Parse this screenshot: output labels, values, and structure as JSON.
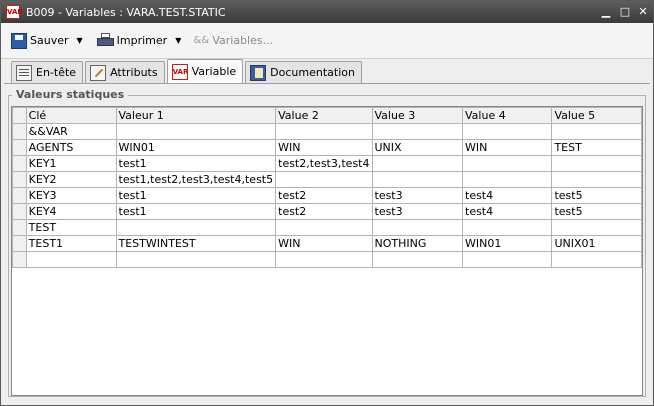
{
  "window": {
    "title": "B009 - Variables : VARA.TEST.STATIC",
    "icon_text": "VAR",
    "icon": "var-icon",
    "controls": [
      "minimize-icon",
      "maximize-icon",
      "close-icon"
    ]
  },
  "toolbar": {
    "save_label": "Sauver",
    "print_label": "Imprimer",
    "variables_label": "Variables...",
    "variables_icon_glyph": "&&",
    "variables_enabled": false
  },
  "tabs": [
    {
      "label": "En-tête",
      "icon": "header-icon",
      "active": false
    },
    {
      "label": "Attributs",
      "icon": "attributes-icon",
      "active": false
    },
    {
      "label": "Variable",
      "icon": "var-icon",
      "icon_text": "VAR",
      "active": true
    },
    {
      "label": "Documentation",
      "icon": "documentation-icon",
      "active": false
    }
  ],
  "group": {
    "title": "Valeurs statiques"
  },
  "table": {
    "columns": [
      "Clé",
      "Valeur 1",
      "Value 2",
      "Value 3",
      "Value 4",
      "Value 5"
    ],
    "rows": [
      [
        "&&VAR",
        "",
        "",
        "",
        "",
        ""
      ],
      [
        "AGENTS",
        "WIN01",
        "WIN",
        "UNIX",
        "WIN",
        "TEST"
      ],
      [
        "KEY1",
        "test1",
        "test2,test3,test4",
        "",
        "",
        ""
      ],
      [
        "KEY2",
        "test1,test2,test3,test4,test5",
        "",
        "",
        "",
        ""
      ],
      [
        "KEY3",
        "test1",
        "test2",
        "test3",
        "test4",
        "test5"
      ],
      [
        "KEY4",
        "test1",
        "test2",
        "test3",
        "test4",
        "test5"
      ],
      [
        "TEST",
        "",
        "",
        "",
        "",
        ""
      ],
      [
        "TEST1",
        "TESTWINTEST",
        "WIN",
        "NOTHING",
        "WIN01",
        "UNIX01"
      ],
      [
        "",
        "",
        "",
        "",
        "",
        ""
      ]
    ]
  }
}
